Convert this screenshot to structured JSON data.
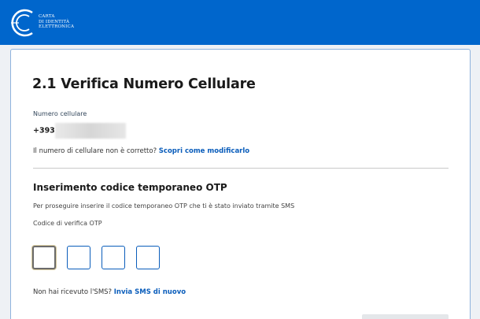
{
  "header": {
    "logo_lines": [
      "CARTA",
      "DI IDENTITÀ",
      "ELETTRONICA"
    ]
  },
  "page": {
    "title": "2.1 Verifica Numero Cellulare"
  },
  "phone": {
    "label": "Numero cellulare",
    "prefix": "+393"
  },
  "change": {
    "text": "Il numero di cellulare non è corretto?",
    "link": "Scopri come modificarlo"
  },
  "otp": {
    "section_title": "Inserimento codice temporaneo OTP",
    "instruction": "Per proseguire inserire il codice temporaneo OTP che ti è stato inviato tramite SMS",
    "field_label": "Codice di verifica OTP",
    "values": [
      "",
      "",
      "",
      ""
    ]
  },
  "resend": {
    "text": "Non hai ricevuto l'SMS?",
    "link": "Invia SMS di nuovo"
  },
  "colors": {
    "header_blue": "#0066cc",
    "link_blue": "#0a5dbb"
  }
}
